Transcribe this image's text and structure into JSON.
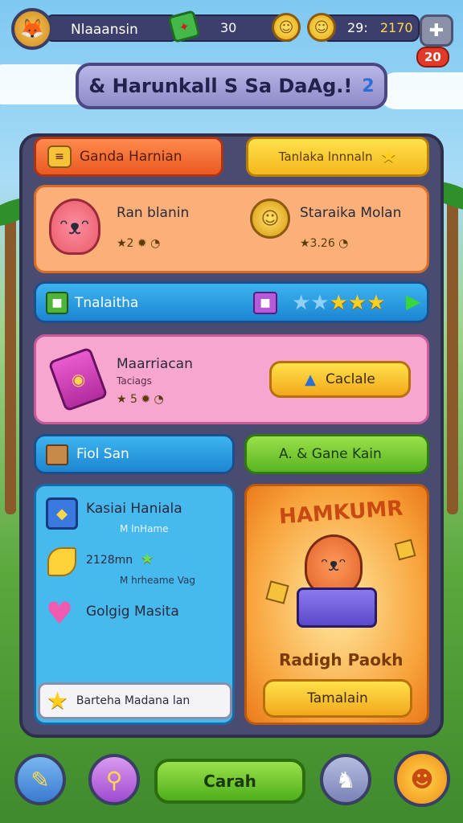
{
  "topbar": {
    "player_name": "Nlaaansin",
    "currency1_value": "30",
    "currency2_value": "29:",
    "currency3_value": "2170",
    "notification_badge": "20"
  },
  "title": {
    "text": "& Harunkall S Sa DaAg.!",
    "badge": "2"
  },
  "tabs": {
    "left_label": "Ganda Harnian",
    "right_label": "Tanlaka lnnnaln"
  },
  "rewards": [
    {
      "name": "Ran blanin",
      "value": "★2 ✹ ◔"
    },
    {
      "name": "Staraika Molan",
      "value": "★3.26 ◔"
    }
  ],
  "progress_bar": {
    "label": "Tnalaitha",
    "stars": 3
  },
  "offer": {
    "title": "Maarriacan",
    "subtitle": "Taciags",
    "stats": "★ 5 ✹ ◔",
    "button_label": "Caclale"
  },
  "section_tabs": {
    "left_label": "Fiol San",
    "right_label": "A. & Gane Kain"
  },
  "info_list": {
    "item1_title": "Kasiai Haniala",
    "item1_sub": "M lnHame",
    "item2_value": "2128mn",
    "item2_sub": "M hrheame Vag",
    "item3_title": "Golgig Masita",
    "footer_label": "Barteha Madana lan"
  },
  "promo": {
    "headline": "HAMKUMR",
    "caption": "Radigh Paokh",
    "button_label": "Tamalain"
  },
  "bottom_nav": {
    "primary_label": "Carah"
  },
  "colors": {
    "panel": "#4a4b70",
    "accent_orange": "#ea5a22",
    "accent_yellow": "#f3b81c",
    "accent_blue": "#1c86d2",
    "accent_green": "#5ab522",
    "accent_pink": "#f7a6cf"
  }
}
